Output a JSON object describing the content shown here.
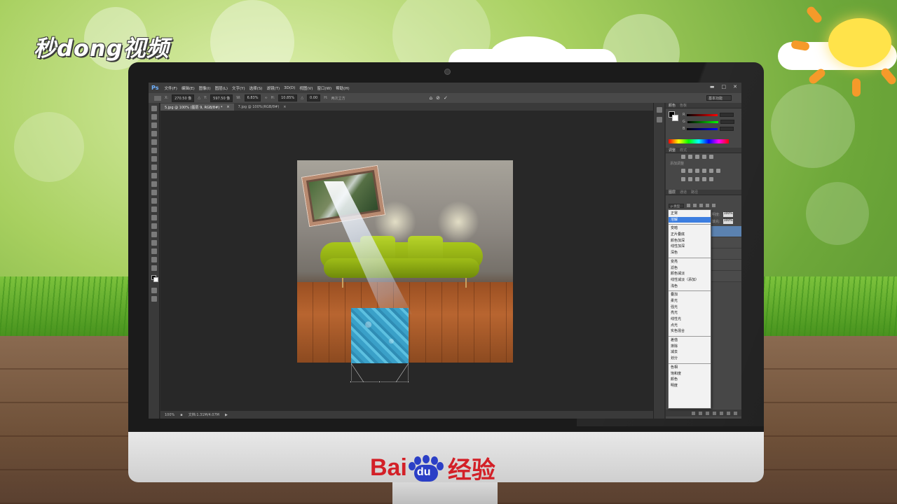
{
  "branding": {
    "watermark": "秒dong视频",
    "baidu_text": "Bai",
    "baidu_paw_text": "du",
    "baidu_suffix": "经验"
  },
  "photoshop": {
    "logo": "Ps",
    "menu": [
      "文件(F)",
      "编辑(E)",
      "图像(I)",
      "图层(L)",
      "文字(Y)",
      "选择(S)",
      "滤镜(T)",
      "3D(D)",
      "视图(V)",
      "窗口(W)",
      "帮助(H)"
    ],
    "window_controls": [
      "▬",
      "□",
      "✕"
    ],
    "options_bar": {
      "x_label": "X:",
      "x_value": "270.50 像",
      "y_label": "Y:",
      "y_value": "597.50 像",
      "w_label": "W:",
      "w_value": "6.83%",
      "h_label": "H:",
      "h_value": "10.85%",
      "angle_label": "△",
      "angle_value": "0.00",
      "h_skew_label": "H:",
      "interpolation": "两次立方",
      "cancel": "⊘",
      "commit": "✓",
      "workspace": "基本功能"
    },
    "tabs": [
      {
        "label": "5.jpg @ 100% (图层 9, RGB/8#) *",
        "close": "×",
        "active": true
      },
      {
        "label": "7.jpg @ 100%(RGB/8#)",
        "close": "×",
        "active": false
      }
    ],
    "status": {
      "zoom": "100%",
      "doc": "文档:1.31M/4.07M"
    },
    "panels": {
      "color_tabs": [
        "颜色",
        "色板"
      ],
      "color_sliders": [
        "R",
        "G",
        "B"
      ],
      "adjust_tabs": [
        "调整",
        "样式"
      ],
      "adjust_hint": "添加调整",
      "layers_tabs": [
        "图层",
        "通道",
        "路径"
      ],
      "layers_filter": "ρ 类型",
      "blend_current": "正常",
      "opacity_label": "不透明度:",
      "opacity_value": "100%",
      "fill_label": "填充:",
      "fill_value": "100%"
    },
    "blend_modes": [
      {
        "items": [
          "正常",
          "溶解"
        ],
        "highlight": "溶解"
      },
      {
        "items": [
          "变暗",
          "正片叠底",
          "颜色加深",
          "线性加深",
          "深色"
        ]
      },
      {
        "items": [
          "变亮",
          "滤色",
          "颜色减淡",
          "线性减淡（添加）",
          "浅色"
        ]
      },
      {
        "items": [
          "叠加",
          "柔光",
          "强光",
          "亮光",
          "线性光",
          "点光",
          "实色混合"
        ]
      },
      {
        "items": [
          "差值",
          "排除",
          "减去",
          "划分"
        ]
      },
      {
        "items": [
          "色相",
          "饱和度",
          "颜色",
          "明度"
        ]
      }
    ]
  },
  "colors": {
    "accent": "#3c7ee0",
    "baidu_red": "#d32027",
    "baidu_blue": "#2b3fc6"
  }
}
